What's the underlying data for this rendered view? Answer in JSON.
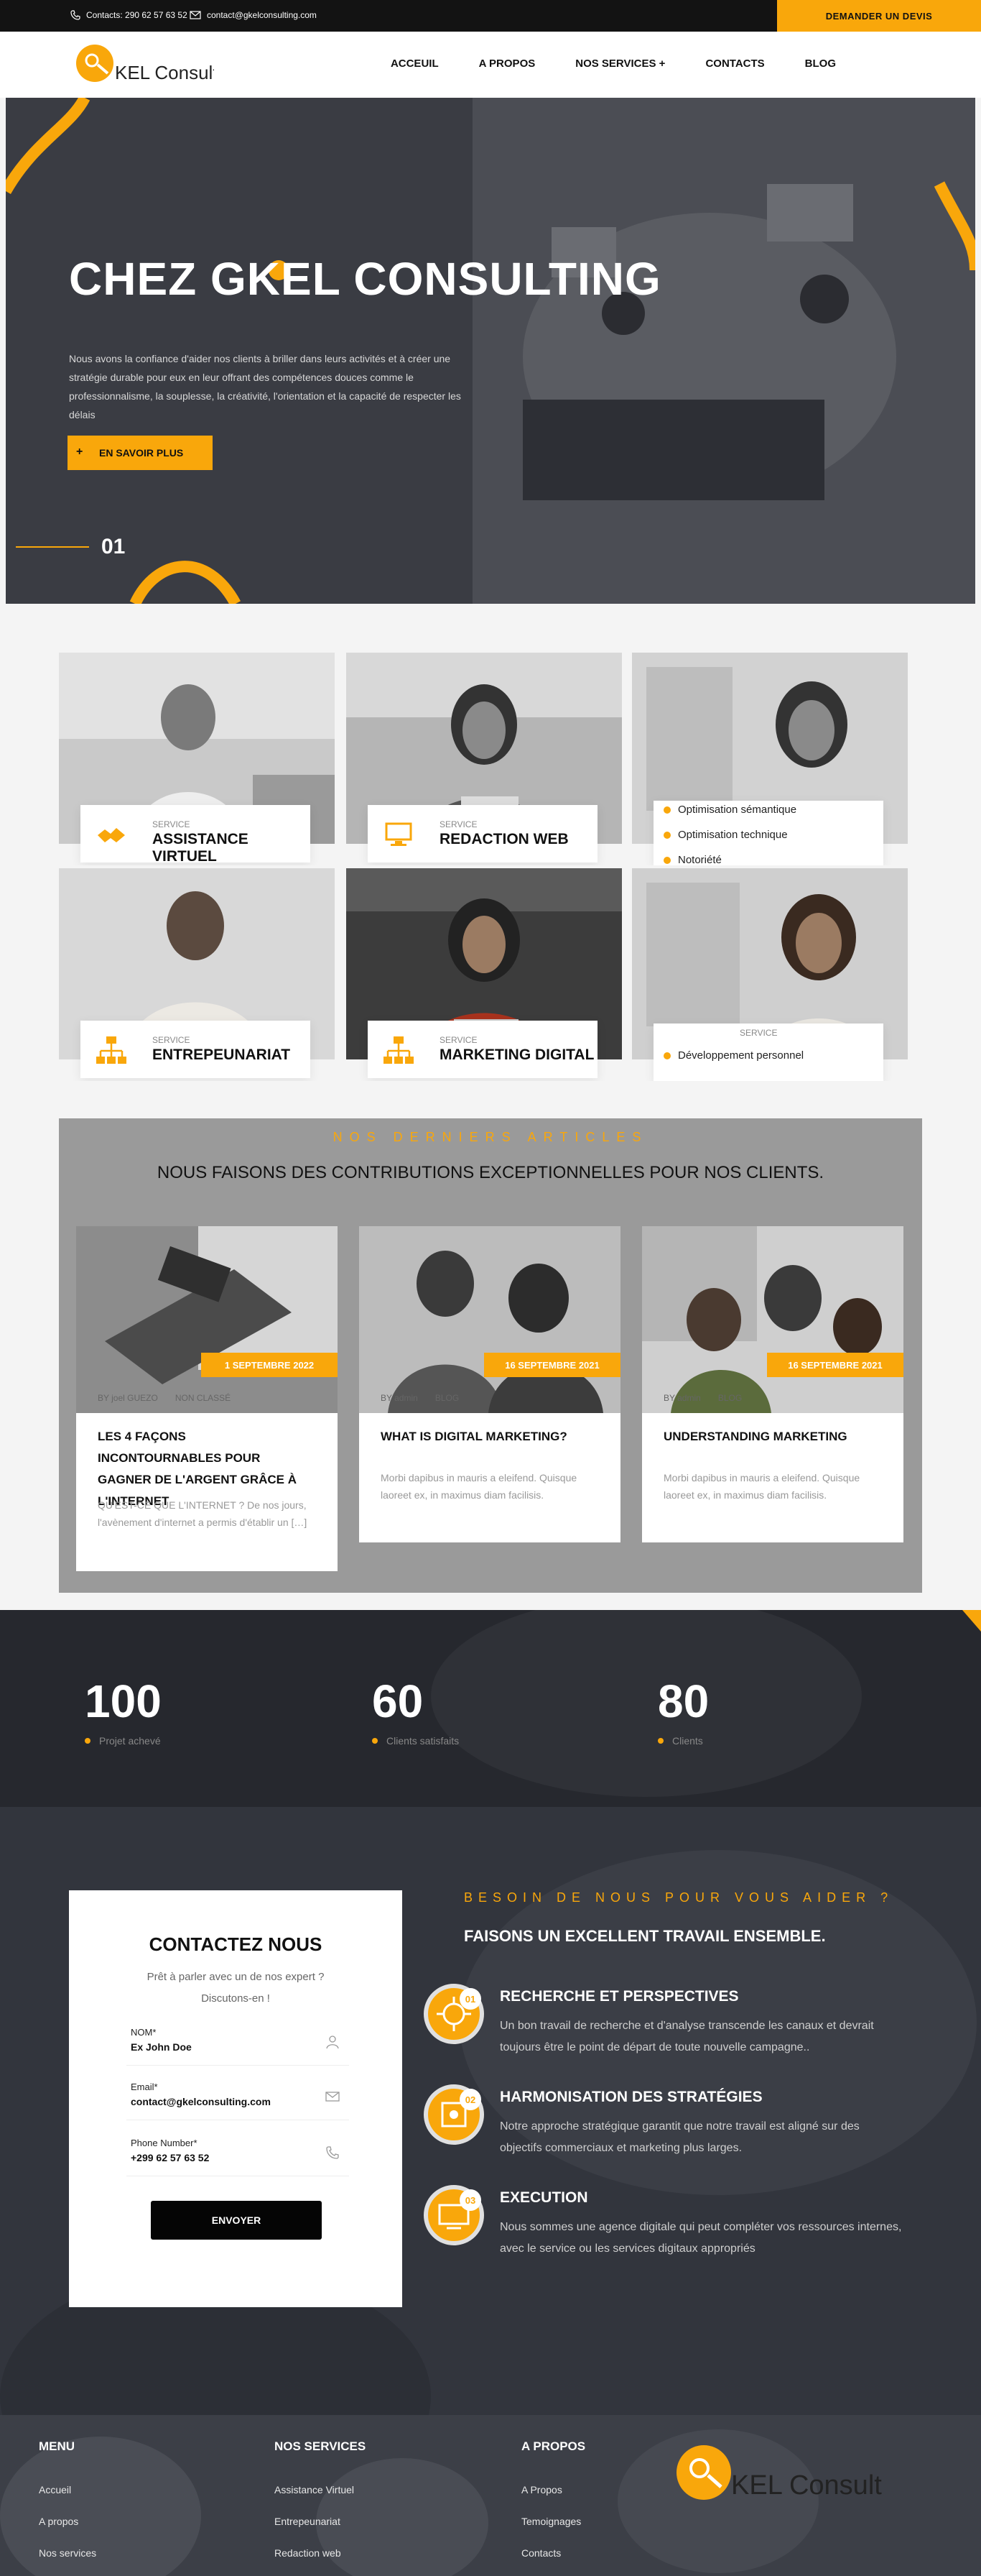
{
  "topbar": {
    "phone": "Contacts: 290 62 57 63 52",
    "email": "contact@gkelconsulting.com",
    "cta": "DEMANDER UN DEVIS"
  },
  "header": {
    "logo_text": "KEL Consulting",
    "nav": [
      "ACCEUIL",
      "A PROPOS",
      "NOS SERVICES +",
      "CONTACTS",
      "BLOG"
    ]
  },
  "hero": {
    "title": "CHEZ GKEL CONSULTING",
    "text": "Nous avons la confiance d'aider nos clients à briller dans leurs activités et à créer une stratégie durable pour eux en leur offrant des compétences douces comme le professionnalisme, la souplesse, la créativité, l'orientation et la capacité de respecter les délais",
    "button": "EN SAVOIR PLUS",
    "slide": "01"
  },
  "services": {
    "label": "SERVICE",
    "items": [
      {
        "title": "ASSISTANCE VIRTUEL"
      },
      {
        "title": "REDACTION WEB"
      },
      {
        "title": "ENTREPEUNARIAT"
      },
      {
        "title": "MARKETING DIGITAL"
      }
    ],
    "hover_list_1": [
      "Optimisation sémantique",
      "Optimisation technique",
      "Notoriété"
    ],
    "hover_list_2": [
      "Développement personnel"
    ]
  },
  "articles": {
    "kicker": "NOS DERNIERS ARTICLES",
    "title": "NOUS FAISONS DES CONTRIBUTIONS EXCEPTIONNELLES POUR NOS CLIENTS.",
    "items": [
      {
        "date": "1 SEPTEMBRE 2022",
        "author": "BY joel GUEZO",
        "category": "NON CLASSÉ",
        "title": "LES 4 FAÇONS INCONTOURNABLES POUR GAGNER DE L'ARGENT GRÂCE À L'INTERNET",
        "excerpt": "QU'EST-CE QUE L'INTERNET ? De nos jours, l'avènement d'internet a permis d'établir un […]"
      },
      {
        "date": "16 SEPTEMBRE 2021",
        "author": "BY admin",
        "category": "BLOG",
        "title": "WHAT IS DIGITAL MARKETING?",
        "excerpt": "Morbi dapibus in mauris a eleifend. Quisque laoreet ex, in maximus diam facilisis."
      },
      {
        "date": "16 SEPTEMBRE 2021",
        "author": "BY admin",
        "category": "BLOG",
        "title": "UNDERSTANDING MARKETING",
        "excerpt": "Morbi dapibus in mauris a eleifend. Quisque laoreet ex, in maximus diam facilisis."
      }
    ]
  },
  "counters": [
    {
      "value": "100",
      "label": "Projet achevé"
    },
    {
      "value": "60",
      "label": "Clients satisfaits"
    },
    {
      "value": "80",
      "label": "Clients"
    }
  ],
  "contact_form": {
    "title": "CONTACTEZ NOUS",
    "subtitle": "Prêt à parler avec un de nos expert ? Discutons-en !",
    "name_label": "NOM*",
    "name_value": "Ex John Doe",
    "email_label": "Email*",
    "email_value": "contact@gkelconsulting.com",
    "phone_label": "Phone Number*",
    "phone_value": "+299 62 57 63 52",
    "submit": "ENVOYER"
  },
  "help": {
    "kicker": "BESOIN DE NOUS POUR VOUS AIDER ?",
    "title": "FAISONS UN EXCELLENT TRAVAIL ENSEMBLE.",
    "steps": [
      {
        "num": "01",
        "title": "RECHERCHE ET PERSPECTIVES",
        "text": "Un bon travail de recherche et d'analyse transcende les canaux et devrait toujours être le point de départ de toute nouvelle campagne.."
      },
      {
        "num": "02",
        "title": "HARMONISATION DES STRATÉGIES",
        "text": "Notre approche stratégique garantit que notre travail est aligné sur des objectifs commerciaux et marketing plus larges."
      },
      {
        "num": "03",
        "title": "EXECUTION",
        "text": "Nous sommes une agence digitale qui peut compléter vos ressources internes, avec le service ou les services digitaux appropriés"
      }
    ]
  },
  "footer": {
    "menu_title": "MENU",
    "menu": [
      "Accueil",
      "A propos",
      "Nos services"
    ],
    "services_title": "NOS SERVICES",
    "services": [
      "Assistance Virtuel",
      "Entrepeunariat",
      "Redaction web"
    ],
    "about_title": "A PROPOS",
    "about": [
      "A Propos",
      "Temoignages",
      "Contacts"
    ],
    "logo_text": "KEL Consulting"
  },
  "colors": {
    "accent": "#f9a70b",
    "dark": "#131313"
  }
}
